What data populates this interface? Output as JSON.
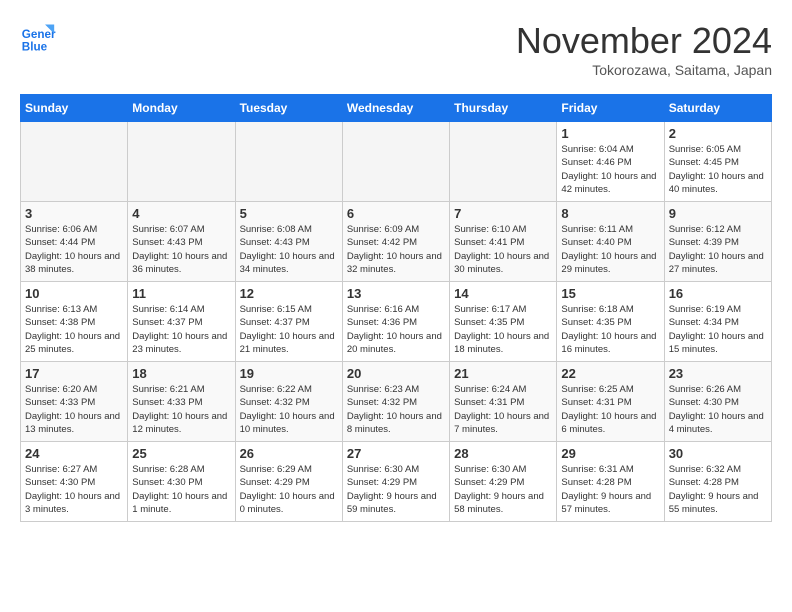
{
  "header": {
    "logo_line1": "General",
    "logo_line2": "Blue",
    "month_title": "November 2024",
    "location": "Tokorozawa, Saitama, Japan"
  },
  "weekdays": [
    "Sunday",
    "Monday",
    "Tuesday",
    "Wednesday",
    "Thursday",
    "Friday",
    "Saturday"
  ],
  "weeks": [
    [
      {
        "day": "",
        "info": ""
      },
      {
        "day": "",
        "info": ""
      },
      {
        "day": "",
        "info": ""
      },
      {
        "day": "",
        "info": ""
      },
      {
        "day": "",
        "info": ""
      },
      {
        "day": "1",
        "info": "Sunrise: 6:04 AM\nSunset: 4:46 PM\nDaylight: 10 hours and 42 minutes."
      },
      {
        "day": "2",
        "info": "Sunrise: 6:05 AM\nSunset: 4:45 PM\nDaylight: 10 hours and 40 minutes."
      }
    ],
    [
      {
        "day": "3",
        "info": "Sunrise: 6:06 AM\nSunset: 4:44 PM\nDaylight: 10 hours and 38 minutes."
      },
      {
        "day": "4",
        "info": "Sunrise: 6:07 AM\nSunset: 4:43 PM\nDaylight: 10 hours and 36 minutes."
      },
      {
        "day": "5",
        "info": "Sunrise: 6:08 AM\nSunset: 4:43 PM\nDaylight: 10 hours and 34 minutes."
      },
      {
        "day": "6",
        "info": "Sunrise: 6:09 AM\nSunset: 4:42 PM\nDaylight: 10 hours and 32 minutes."
      },
      {
        "day": "7",
        "info": "Sunrise: 6:10 AM\nSunset: 4:41 PM\nDaylight: 10 hours and 30 minutes."
      },
      {
        "day": "8",
        "info": "Sunrise: 6:11 AM\nSunset: 4:40 PM\nDaylight: 10 hours and 29 minutes."
      },
      {
        "day": "9",
        "info": "Sunrise: 6:12 AM\nSunset: 4:39 PM\nDaylight: 10 hours and 27 minutes."
      }
    ],
    [
      {
        "day": "10",
        "info": "Sunrise: 6:13 AM\nSunset: 4:38 PM\nDaylight: 10 hours and 25 minutes."
      },
      {
        "day": "11",
        "info": "Sunrise: 6:14 AM\nSunset: 4:37 PM\nDaylight: 10 hours and 23 minutes."
      },
      {
        "day": "12",
        "info": "Sunrise: 6:15 AM\nSunset: 4:37 PM\nDaylight: 10 hours and 21 minutes."
      },
      {
        "day": "13",
        "info": "Sunrise: 6:16 AM\nSunset: 4:36 PM\nDaylight: 10 hours and 20 minutes."
      },
      {
        "day": "14",
        "info": "Sunrise: 6:17 AM\nSunset: 4:35 PM\nDaylight: 10 hours and 18 minutes."
      },
      {
        "day": "15",
        "info": "Sunrise: 6:18 AM\nSunset: 4:35 PM\nDaylight: 10 hours and 16 minutes."
      },
      {
        "day": "16",
        "info": "Sunrise: 6:19 AM\nSunset: 4:34 PM\nDaylight: 10 hours and 15 minutes."
      }
    ],
    [
      {
        "day": "17",
        "info": "Sunrise: 6:20 AM\nSunset: 4:33 PM\nDaylight: 10 hours and 13 minutes."
      },
      {
        "day": "18",
        "info": "Sunrise: 6:21 AM\nSunset: 4:33 PM\nDaylight: 10 hours and 12 minutes."
      },
      {
        "day": "19",
        "info": "Sunrise: 6:22 AM\nSunset: 4:32 PM\nDaylight: 10 hours and 10 minutes."
      },
      {
        "day": "20",
        "info": "Sunrise: 6:23 AM\nSunset: 4:32 PM\nDaylight: 10 hours and 8 minutes."
      },
      {
        "day": "21",
        "info": "Sunrise: 6:24 AM\nSunset: 4:31 PM\nDaylight: 10 hours and 7 minutes."
      },
      {
        "day": "22",
        "info": "Sunrise: 6:25 AM\nSunset: 4:31 PM\nDaylight: 10 hours and 6 minutes."
      },
      {
        "day": "23",
        "info": "Sunrise: 6:26 AM\nSunset: 4:30 PM\nDaylight: 10 hours and 4 minutes."
      }
    ],
    [
      {
        "day": "24",
        "info": "Sunrise: 6:27 AM\nSunset: 4:30 PM\nDaylight: 10 hours and 3 minutes."
      },
      {
        "day": "25",
        "info": "Sunrise: 6:28 AM\nSunset: 4:30 PM\nDaylight: 10 hours and 1 minute."
      },
      {
        "day": "26",
        "info": "Sunrise: 6:29 AM\nSunset: 4:29 PM\nDaylight: 10 hours and 0 minutes."
      },
      {
        "day": "27",
        "info": "Sunrise: 6:30 AM\nSunset: 4:29 PM\nDaylight: 9 hours and 59 minutes."
      },
      {
        "day": "28",
        "info": "Sunrise: 6:30 AM\nSunset: 4:29 PM\nDaylight: 9 hours and 58 minutes."
      },
      {
        "day": "29",
        "info": "Sunrise: 6:31 AM\nSunset: 4:28 PM\nDaylight: 9 hours and 57 minutes."
      },
      {
        "day": "30",
        "info": "Sunrise: 6:32 AM\nSunset: 4:28 PM\nDaylight: 9 hours and 55 minutes."
      }
    ]
  ]
}
